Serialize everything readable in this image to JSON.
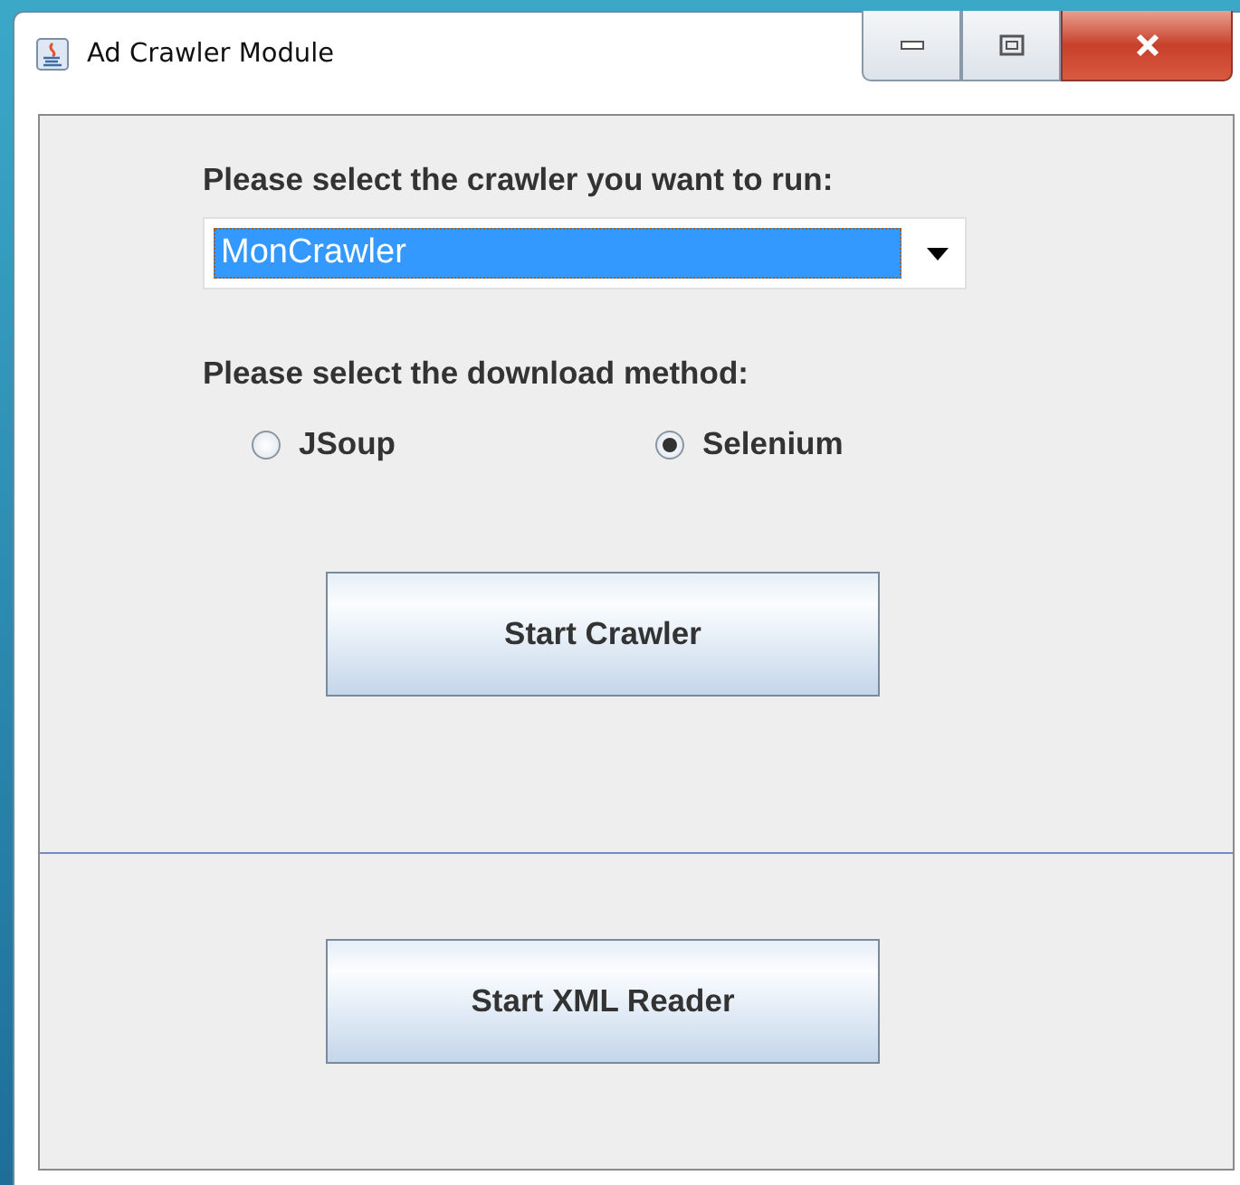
{
  "window": {
    "title": "Ad Crawler Module"
  },
  "crawler_label": "Please select the crawler you want to run:",
  "crawler_dropdown": {
    "value": "MonCrawler"
  },
  "method_label": "Please select the download method:",
  "methods": [
    {
      "label": "JSoup",
      "selected": false
    },
    {
      "label": "Selenium",
      "selected": true
    }
  ],
  "buttons": [
    "Start Crawler",
    "Start XML Reader"
  ]
}
